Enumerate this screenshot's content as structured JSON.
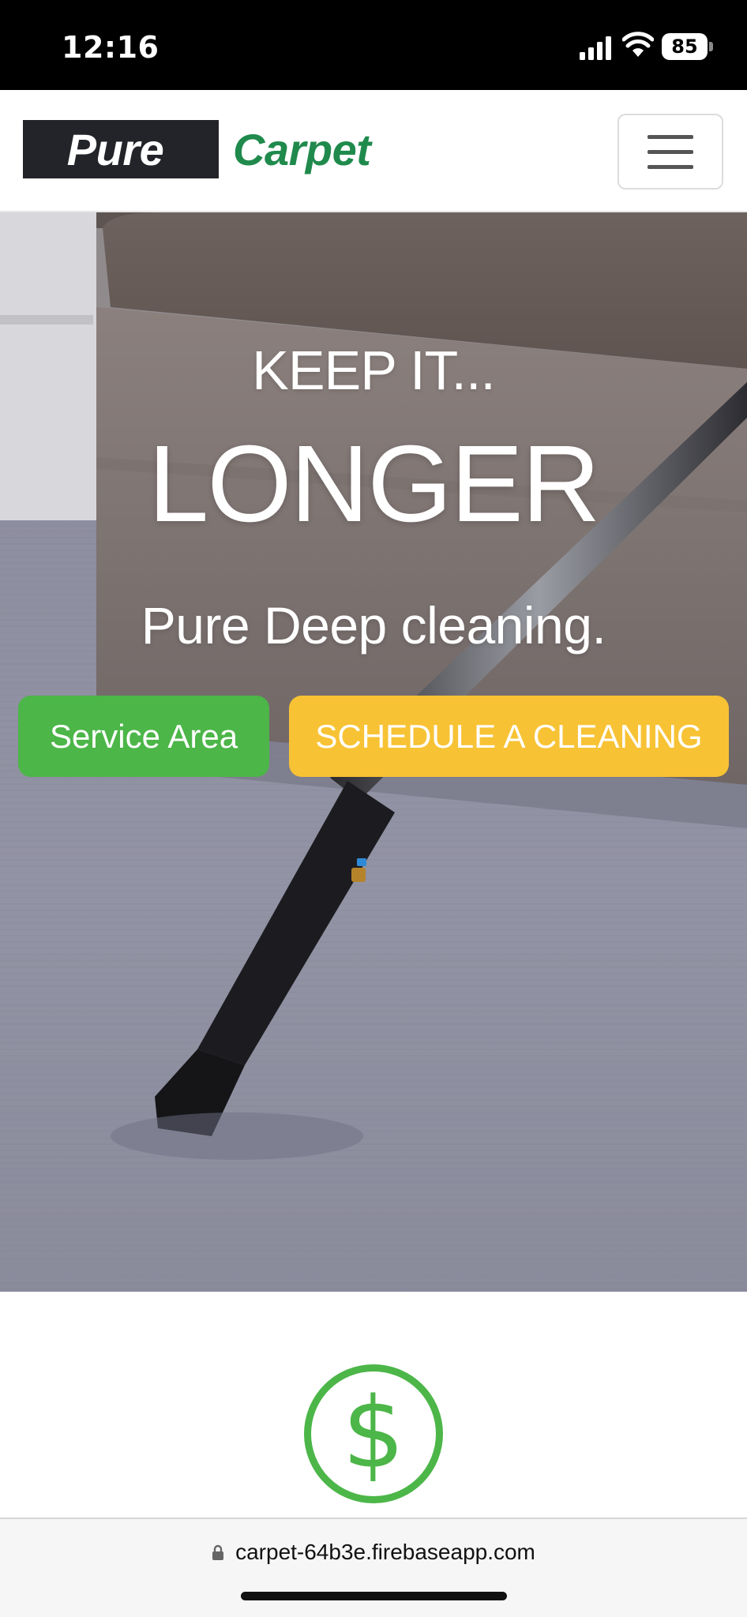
{
  "status_bar": {
    "time": "12:16",
    "battery_level": "85",
    "icons": [
      "signal-icon",
      "wifi-icon",
      "battery-icon"
    ]
  },
  "navbar": {
    "logo_part1": "Pure",
    "logo_part2": "Carpet",
    "menu_icon": "hamburger-icon"
  },
  "hero": {
    "title_small": "KEEP IT...",
    "title_big": "LONGER",
    "subtitle": "Pure Deep cleaning.",
    "buttons": {
      "service_area": "Service Area",
      "schedule": "SCHEDULE A CLEANING"
    }
  },
  "features": {
    "icon": "dollar-icon",
    "dollar_glyph": "$"
  },
  "browser": {
    "url": "carpet-64b3e.firebaseapp.com"
  },
  "colors": {
    "brand_green": "#1f8a4c",
    "button_green": "#4cb648",
    "button_yellow": "#f7c234",
    "logo_dark": "#222429"
  }
}
